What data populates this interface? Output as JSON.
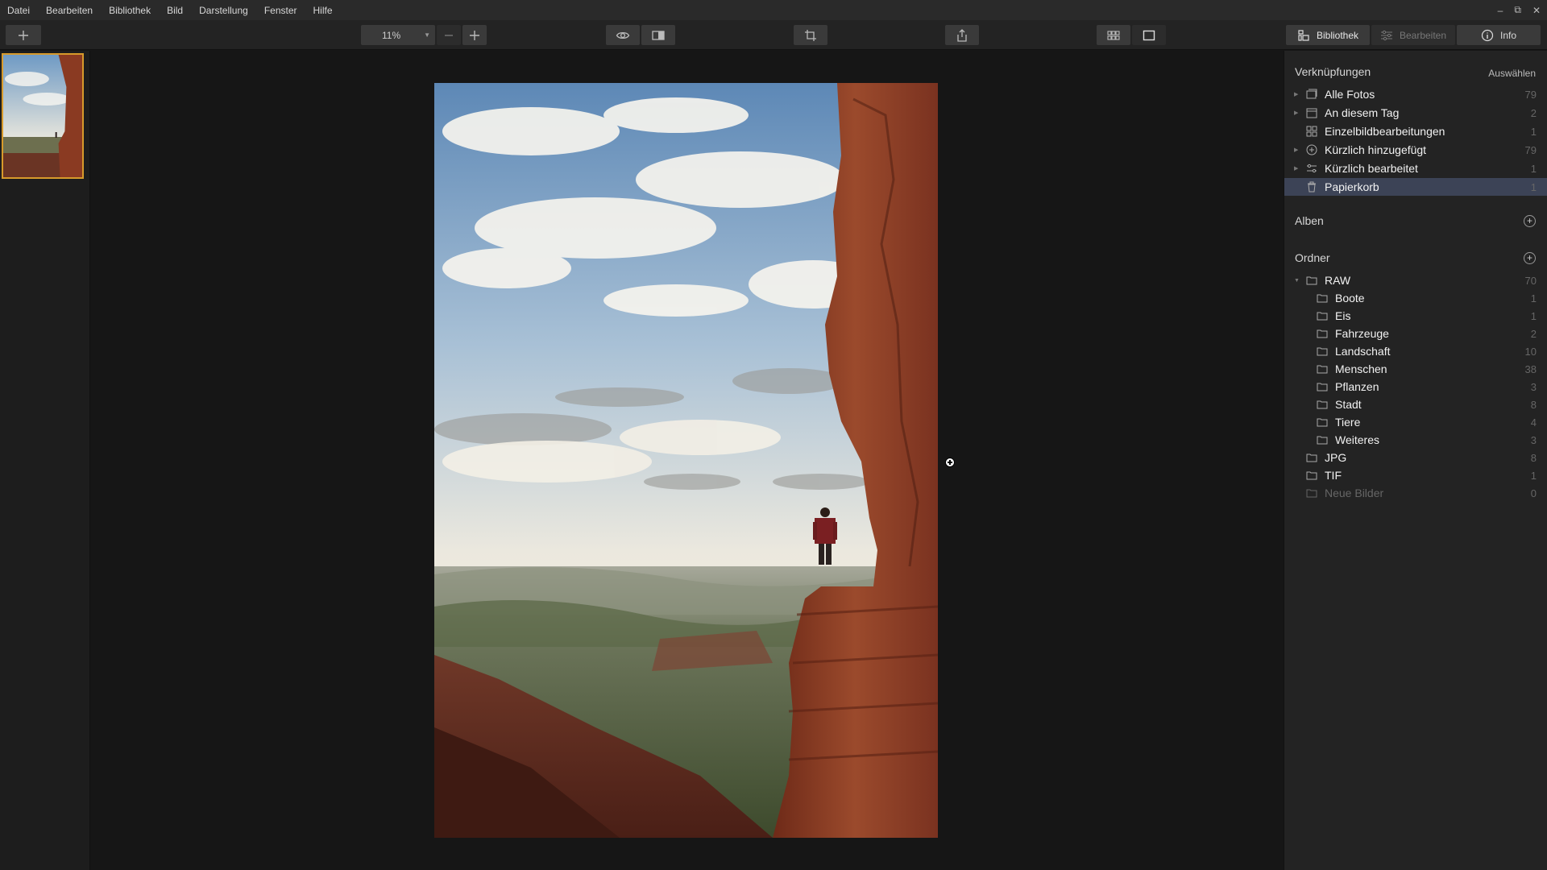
{
  "menubar": {
    "items": [
      "Datei",
      "Bearbeiten",
      "Bibliothek",
      "Bild",
      "Darstellung",
      "Fenster",
      "Hilfe"
    ]
  },
  "toolbar": {
    "zoom_value": "11%",
    "add_icon": "plus-icon",
    "zoom_out_icon": "minus-icon",
    "zoom_in_icon": "plus-icon"
  },
  "mode_tabs": {
    "library": "Bibliothek",
    "edit": "Bearbeiten",
    "info": "Info"
  },
  "shortcuts": {
    "title": "Verknüpfungen",
    "action": "Auswählen",
    "items": [
      {
        "label": "Alle Fotos",
        "count": "79",
        "icon": "photos-icon"
      },
      {
        "label": "An diesem Tag",
        "count": "2",
        "icon": "calendar-icon"
      },
      {
        "label": "Einzelbildbearbeitungen",
        "count": "1",
        "icon": "grid-icon"
      },
      {
        "label": "Kürzlich hinzugefügt",
        "count": "79",
        "icon": "add-circle-icon"
      },
      {
        "label": "Kürzlich bearbeitet",
        "count": "1",
        "icon": "sliders-icon"
      },
      {
        "label": "Papierkorb",
        "count": "1",
        "icon": "trash-icon"
      }
    ]
  },
  "albums": {
    "title": "Alben"
  },
  "folders": {
    "title": "Ordner",
    "raw": {
      "label": "RAW",
      "count": "70"
    },
    "children": [
      {
        "label": "Boote",
        "count": "1"
      },
      {
        "label": "Eis",
        "count": "1"
      },
      {
        "label": "Fahrzeuge",
        "count": "2"
      },
      {
        "label": "Landschaft",
        "count": "10"
      },
      {
        "label": "Menschen",
        "count": "38"
      },
      {
        "label": "Pflanzen",
        "count": "3"
      },
      {
        "label": "Stadt",
        "count": "8"
      },
      {
        "label": "Tiere",
        "count": "4"
      },
      {
        "label": "Weiteres",
        "count": "3"
      }
    ],
    "top": [
      {
        "label": "JPG",
        "count": "8"
      },
      {
        "label": "TIF",
        "count": "1"
      },
      {
        "label": "Neue Bilder",
        "count": "0"
      }
    ]
  },
  "colors": {
    "accent_selection": "#3c4356",
    "thumb_border": "#d79a2b"
  }
}
